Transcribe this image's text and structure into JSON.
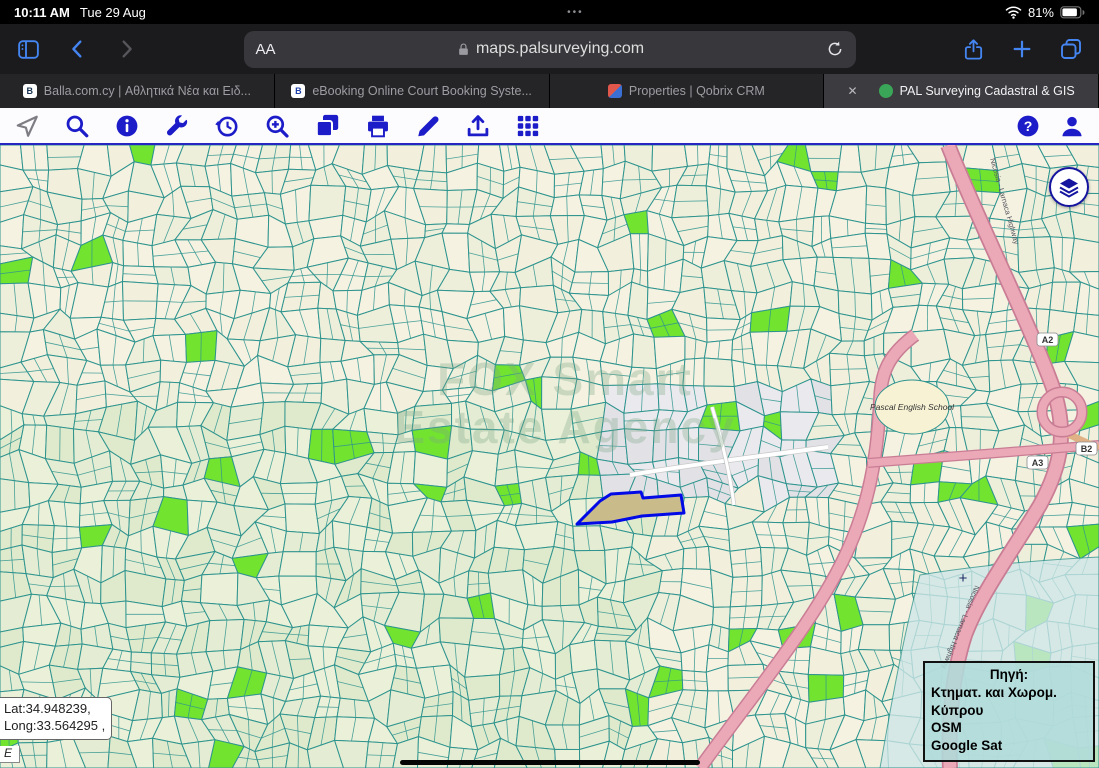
{
  "status_bar": {
    "time": "10:11 AM",
    "date": "Tue 29 Aug",
    "center_dots": "•••",
    "battery_percent": "81%"
  },
  "browser_bar": {
    "reader_button": "AA",
    "url": "maps.palsurveying.com"
  },
  "tab_bar": {
    "tabs": [
      {
        "label": "Balla.com.cy | Αθλητικά Νέα και Ειδ..."
      },
      {
        "label": "eBooking Online Court Booking Syste..."
      },
      {
        "label": "Properties | Qobrix CRM"
      },
      {
        "label": "PAL Surveying Cadastral & GIS"
      }
    ]
  },
  "map": {
    "school_label": "Pascal English School",
    "highway_label": "Nicosia - Larnaca Highway",
    "route_a2": "A2",
    "route_a3": "A3",
    "route_b2": "B2",
    "plus_marker": "+",
    "watermark_line1": "FOX Smart",
    "watermark_line2": "Estate Agency",
    "coordinates": {
      "line1": "Lat:34.948239,",
      "line2": "Long:33.564295 ,",
      "hemisphere": "E"
    },
    "legend": {
      "title": "Πηγή:",
      "items": [
        "Κτηματ. και Χωρομ. Κύπρου",
        "OSM",
        "Google Sat"
      ]
    }
  }
}
